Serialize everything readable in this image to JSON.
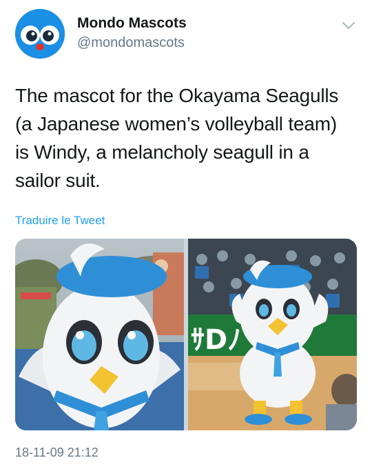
{
  "account": {
    "display_name": "Mondo Mascots",
    "handle": "@mondomascots"
  },
  "tweet": {
    "lines": [
      "The mascot for the Okayama Seagulls",
      "(a Japanese women’s volleyball team)",
      "is Windy, a melancholy seagull in a",
      "sailor suit."
    ],
    "translate_label": "Traduire le Tweet",
    "timestamp": "18-11-09 21:12"
  },
  "media": {
    "photo_count": 2,
    "right_photo_sign_text": "ｻDﾉ"
  },
  "icons": {
    "menu": "chevron-down-icon",
    "avatar": "mascot-avatar"
  },
  "colors": {
    "link": "#1da1f2",
    "secondary_text": "#657786",
    "avatar_bg": "#1a8fe3",
    "mascot_beret": "#2f8fd6",
    "mascot_beak": "#f2c230"
  }
}
